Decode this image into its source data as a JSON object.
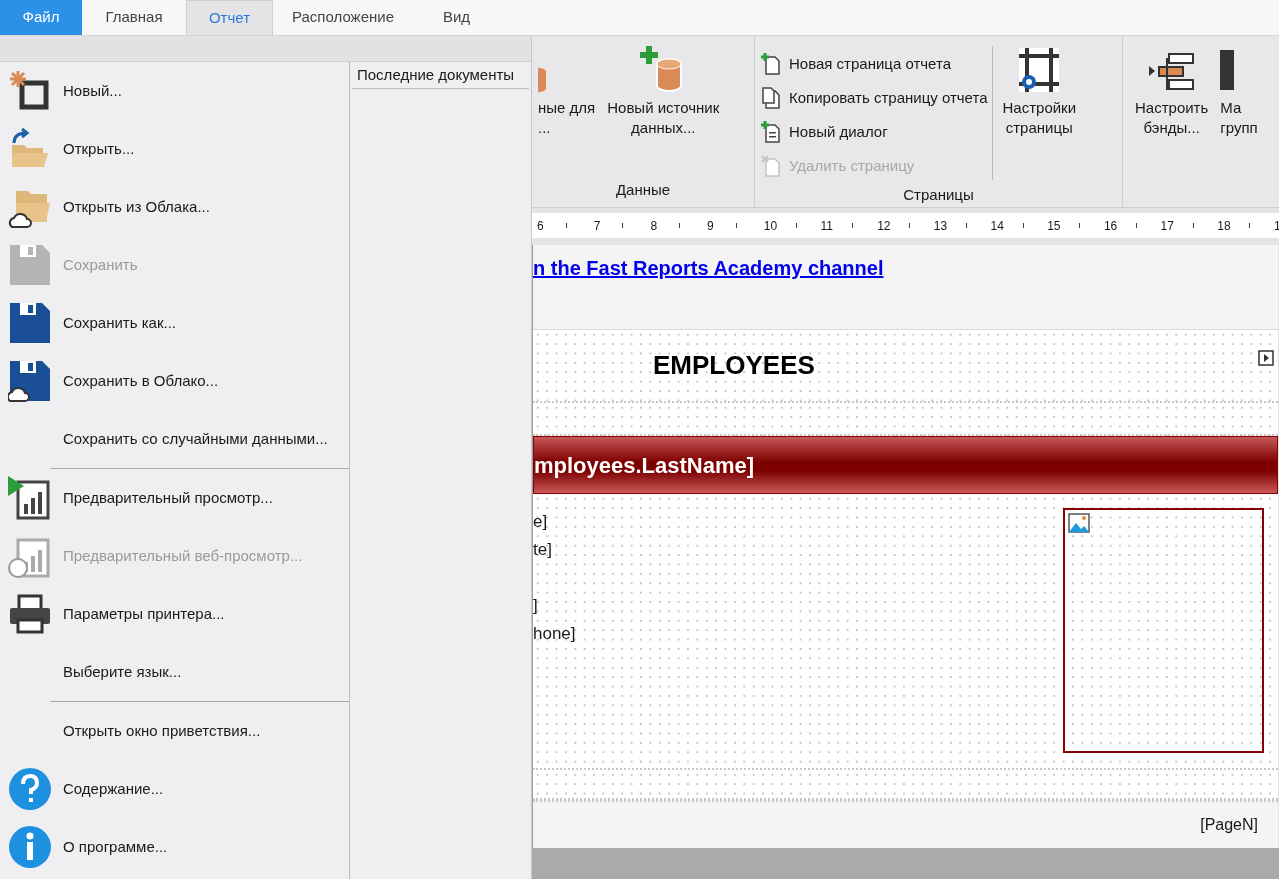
{
  "tabs": [
    {
      "label": "Файл",
      "kind": "file",
      "open": true
    },
    {
      "label": "Главная",
      "kind": "tab",
      "selected": false
    },
    {
      "label": "Отчет",
      "kind": "tab",
      "selected": true
    },
    {
      "label": "Расположение",
      "kind": "tab",
      "selected": false
    },
    {
      "label": "Вид",
      "kind": "tab",
      "selected": false
    }
  ],
  "file_menu": {
    "items": [
      {
        "kind": "command",
        "label": "Новый...",
        "disabled": false
      },
      {
        "kind": "command",
        "label": "Открыть...",
        "disabled": false
      },
      {
        "kind": "command",
        "label": "Открыть из Облака...",
        "disabled": false
      },
      {
        "kind": "command",
        "label": "Сохранить",
        "disabled": true
      },
      {
        "kind": "command",
        "label": "Сохранить как...",
        "disabled": false
      },
      {
        "kind": "command",
        "label": "Сохранить в Облако...",
        "disabled": false
      },
      {
        "kind": "command",
        "label": "Сохранить со случайными данными...",
        "disabled": false
      },
      {
        "kind": "separator"
      },
      {
        "kind": "command",
        "label": "Предварительный просмотр...",
        "disabled": false
      },
      {
        "kind": "command",
        "label": "Предварительный веб-просмотр...",
        "disabled": true
      },
      {
        "kind": "command",
        "label": "Параметры принтера...",
        "disabled": false
      },
      {
        "kind": "command",
        "label": "Выберите язык...",
        "disabled": false
      },
      {
        "kind": "separator"
      },
      {
        "kind": "command",
        "label": "Открыть окно приветствия...",
        "disabled": false
      },
      {
        "kind": "command",
        "label": "Содержание...",
        "disabled": false
      },
      {
        "kind": "command",
        "label": "О программе...",
        "disabled": false
      }
    ],
    "recent": {
      "title": "Последние документы"
    }
  },
  "ribbon": {
    "groups": [
      {
        "label": "Данные",
        "items": [
          {
            "kind": "large",
            "label": "ные для\n...",
            "disabled": false
          },
          {
            "kind": "large",
            "label": "Новый источник\nданных...",
            "disabled": false
          }
        ]
      },
      {
        "label": "Страницы",
        "items": [
          {
            "kind": "stack",
            "buttons": [
              {
                "label": "Новая страница отчета",
                "disabled": false
              },
              {
                "label": "Копировать страницу отчета",
                "disabled": false
              },
              {
                "label": "Новый диалог",
                "disabled": false
              },
              {
                "label": "Удалить страницу",
                "disabled": true
              }
            ]
          },
          {
            "kind": "divider"
          },
          {
            "kind": "large",
            "label": "Настройки\nстраницы",
            "disabled": false
          }
        ]
      },
      {
        "items": [
          {
            "kind": "large",
            "label": "Настроить\nбэнды...",
            "disabled": false
          },
          {
            "kind": "large",
            "label": "Ма\nгрупп",
            "disabled": false
          }
        ]
      }
    ]
  },
  "ruler": {
    "marks": [
      "6",
      "7",
      "8",
      "9",
      "10",
      "11",
      "12",
      "13",
      "14",
      "15",
      "16",
      "17",
      "18",
      "1"
    ]
  },
  "report": {
    "bands": [
      {
        "kind": "title",
        "link": "n the Fast Reports Academy channel"
      },
      {
        "kind": "header",
        "text": "EMPLOYEES"
      },
      {
        "kind": "blank"
      },
      {
        "kind": "group_header",
        "text": "mployees.LastName]"
      },
      {
        "kind": "data",
        "fields": [
          "e]",
          "te]",
          "]",
          "hone]"
        ]
      },
      {
        "kind": "blank"
      },
      {
        "kind": "footer",
        "text": "[PageN]"
      }
    ]
  }
}
